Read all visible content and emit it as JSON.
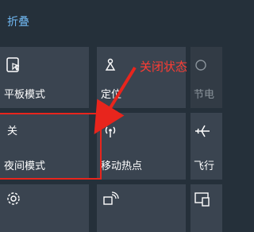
{
  "panel": {
    "collapse_label": "折叠"
  },
  "tiles": {
    "tablet_mode": {
      "label": "平板模式",
      "icon": "tablet-mode-icon"
    },
    "location": {
      "label": "定位",
      "icon": "location-icon"
    },
    "battery_saver": {
      "label": "节电",
      "icon": "battery-saver-icon"
    },
    "night_light": {
      "state": "关",
      "label": "夜间模式",
      "icon": "night-light-icon"
    },
    "mobile_hotspot": {
      "label": "移动热点",
      "icon": "mobile-hotspot-icon"
    },
    "airplane_mode": {
      "label": "飞行",
      "icon": "airplane-icon"
    },
    "settings": {
      "icon": "gear-icon"
    },
    "project": {
      "icon": "project-icon"
    },
    "connect": {
      "icon": "connect-icon"
    }
  },
  "annotation": {
    "text": "关闭状态",
    "color": "#ff3c33"
  },
  "colors": {
    "background": "#25303a",
    "tile": "#3a4450",
    "accent": "#6fb6ef"
  }
}
